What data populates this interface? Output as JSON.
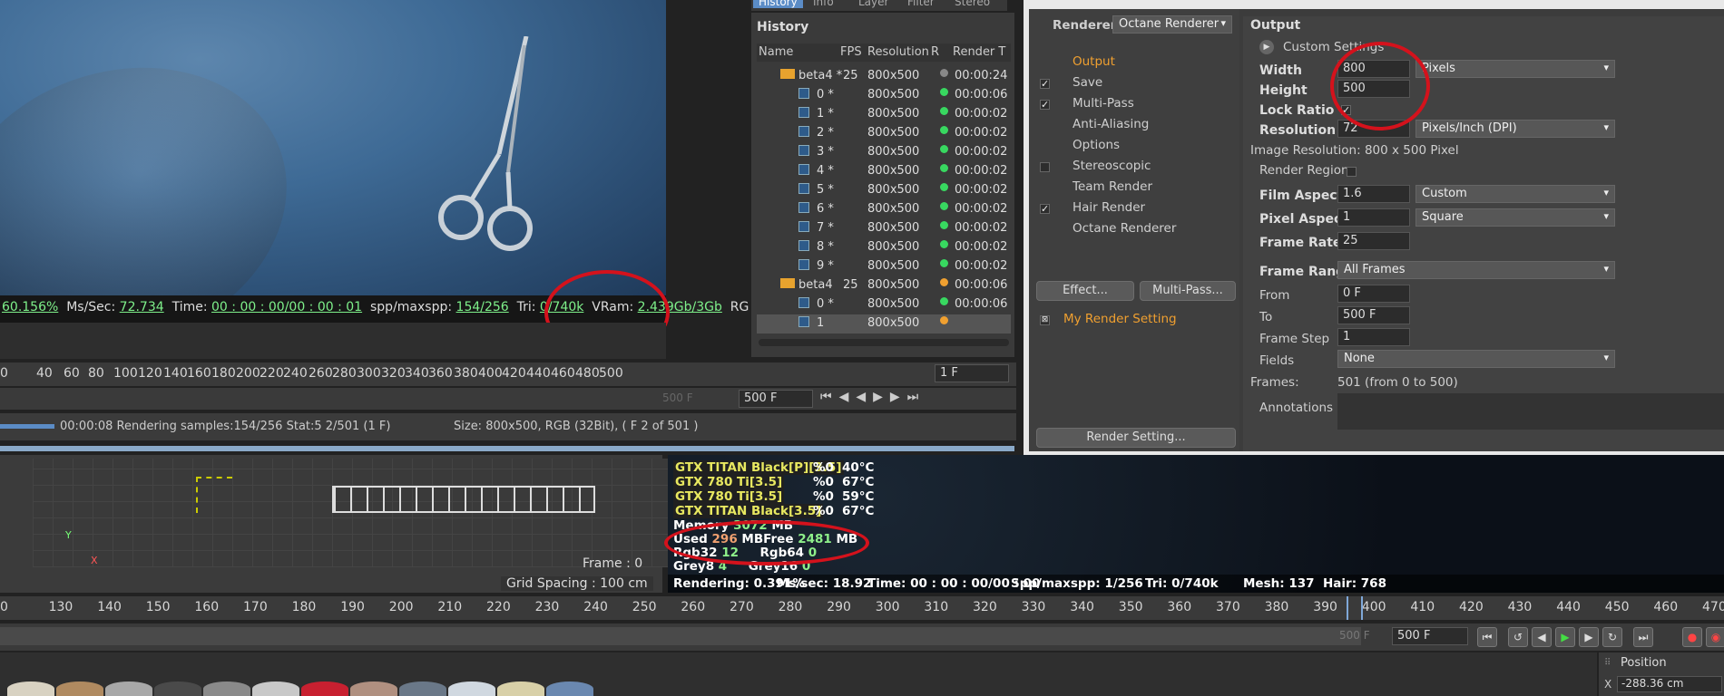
{
  "render_stats": {
    "progress": "60.156%",
    "ms_label": "Ms/Sec:",
    "ms_value": "72.734",
    "time_label": "Time:",
    "time_value": "00 : 00 : 00/00 : 00 : 01",
    "spp_label": "spp/maxspp:",
    "spp_value": "154/256",
    "tri_label": "Tri:",
    "tri_value": "0/740k",
    "vram_label": "VRam:",
    "vram_value": "2.439Gb/3Gb",
    "rg": "RG"
  },
  "top_ruler": [
    "0",
    "40",
    "60",
    "80",
    "100",
    "120",
    "140",
    "160",
    "180",
    "200",
    "220",
    "240",
    "260",
    "280",
    "300",
    "320",
    "340",
    "360",
    "380",
    "400",
    "420",
    "440",
    "460",
    "480",
    "500"
  ],
  "frame_field": "1 F",
  "end_frame_ghost": "500 F",
  "end_frame": "500 F",
  "status_left": "00:00:08 Rendering samples:154/256 Stat:5 2/501 (1 F)",
  "status_right": "Size: 800x500, RGB (32Bit),  ( F 2 of 501 )",
  "history": {
    "tabs": [
      "History",
      "Info",
      "Layer",
      "Filter",
      "Stereo"
    ],
    "title": "History",
    "columns": [
      "Name",
      "FPS",
      "Resolution",
      "R",
      "Render T"
    ],
    "rows": [
      {
        "name": "beta4 *",
        "fps": "25",
        "res": "800x500",
        "status": "gray",
        "time": "00:00:24"
      },
      {
        "name": "0 *",
        "fps": "",
        "res": "800x500",
        "status": "green",
        "time": "00:00:06"
      },
      {
        "name": "1 *",
        "fps": "",
        "res": "800x500",
        "status": "green",
        "time": "00:00:02"
      },
      {
        "name": "2 *",
        "fps": "",
        "res": "800x500",
        "status": "green",
        "time": "00:00:02"
      },
      {
        "name": "3 *",
        "fps": "",
        "res": "800x500",
        "status": "green",
        "time": "00:00:02"
      },
      {
        "name": "4 *",
        "fps": "",
        "res": "800x500",
        "status": "green",
        "time": "00:00:02"
      },
      {
        "name": "5 *",
        "fps": "",
        "res": "800x500",
        "status": "green",
        "time": "00:00:02"
      },
      {
        "name": "6 *",
        "fps": "",
        "res": "800x500",
        "status": "green",
        "time": "00:00:02"
      },
      {
        "name": "7 *",
        "fps": "",
        "res": "800x500",
        "status": "green",
        "time": "00:00:02"
      },
      {
        "name": "8 *",
        "fps": "",
        "res": "800x500",
        "status": "green",
        "time": "00:00:02"
      },
      {
        "name": "9 *",
        "fps": "",
        "res": "800x500",
        "status": "green",
        "time": "00:00:02"
      },
      {
        "name": "beta4",
        "fps": "25",
        "res": "800x500",
        "status": "orange",
        "time": "00:00:06"
      },
      {
        "name": "0 *",
        "fps": "",
        "res": "800x500",
        "status": "green",
        "time": "00:00:06"
      },
      {
        "name": "1",
        "fps": "",
        "res": "800x500",
        "status": "orange",
        "time": ""
      }
    ]
  },
  "render_settings": {
    "renderer_label": "Renderer",
    "renderer_value": "Octane Renderer",
    "left_items": [
      "Output",
      "Save",
      "Multi-Pass",
      "Anti-Aliasing",
      "Options",
      "Stereoscopic",
      "Team Render",
      "Hair Render",
      "Octane Renderer"
    ],
    "effect_btn": "Effect...",
    "multipass_btn": "Multi-Pass...",
    "preset": "My Render Setting",
    "render_setting_btn": "Render Setting...",
    "output_title": "Output",
    "custom_settings": "Custom Settings",
    "width_label": "Width",
    "width_value": "800",
    "units": "Pixels",
    "height_label": "Height",
    "height_value": "500",
    "lock_label": "Lock Ratio",
    "resolution_label": "Resolution",
    "resolution_value": "72",
    "resolution_unit": "Pixels/Inch (DPI)",
    "image_resolution": "Image Resolution: 800 x 500 Pixel",
    "render_region": "Render Region",
    "film_aspect_label": "Film Aspect",
    "film_aspect_value": "1.6",
    "film_aspect_mode": "Custom",
    "pixel_aspect_label": "Pixel Aspect",
    "pixel_aspect_value": "1",
    "pixel_aspect_mode": "Square",
    "frame_rate_label": "Frame Rate",
    "frame_rate_value": "25",
    "frame_range_label": "Frame Range",
    "frame_range_value": "All Frames",
    "from_label": "From",
    "from_value": "0 F",
    "to_label": "To",
    "to_value": "500 F",
    "frame_step_label": "Frame Step",
    "frame_step_value": "1",
    "fields_label": "Fields",
    "fields_value": "None",
    "frames_label": "Frames:",
    "frames_value": "501 (from 0 to 500)",
    "annotations_label": "Annotations"
  },
  "viewport": {
    "frame": "Frame : 0",
    "grid": "Grid Spacing : 100 cm",
    "axis_y": "Y",
    "axis_x": "X"
  },
  "gpu_stats": {
    "gpus": [
      {
        "name": "GTX TITAN Black[P][3.5]",
        "load": "%0",
        "temp": "40°C"
      },
      {
        "name": "GTX 780 Ti[3.5]",
        "load": "%0",
        "temp": "67°C"
      },
      {
        "name": "GTX 780 Ti[3.5]",
        "load": "%0",
        "temp": "59°C"
      },
      {
        "name": "GTX TITAN Black[3.5]",
        "load": "%0",
        "temp": "67°C"
      }
    ],
    "memory_label": "Memory",
    "memory_value": "3072",
    "memory_unit": "MB",
    "used_label": "Used",
    "used_value": "296",
    "used_unit": "MB",
    "free_label": "Free",
    "free_value": "2481",
    "free_unit": "MB",
    "rgb32_label": "Rgb32",
    "rgb32_value": "12",
    "rgb64_label": "Rgb64",
    "rgb64_value": "0",
    "grey8_label": "Grey8",
    "grey8_value": "4",
    "grey16_label": "Grey16",
    "grey16_value": "0",
    "rendering": "Rendering: 0.391%",
    "ms": "Ms/sec: 18.92",
    "time": "Time: 00 : 00 : 00/00 : 00",
    "spp": "Spp/maxspp: 1/256",
    "tri": "Tri: 0/740k",
    "mesh": "Mesh: 137",
    "hair": "Hair: 768"
  },
  "bottom_ruler": [
    "0",
    "130",
    "140",
    "150",
    "160",
    "170",
    "180",
    "190",
    "200",
    "210",
    "220",
    "230",
    "240",
    "250",
    "260",
    "270",
    "280",
    "290",
    "300",
    "310",
    "320",
    "330",
    "340",
    "350",
    "360",
    "370",
    "380",
    "390",
    "400",
    "410",
    "420",
    "430",
    "440",
    "450",
    "460",
    "470"
  ],
  "bottom_end_ghost": "500 F",
  "bottom_end": "500 F",
  "position_title": "Position",
  "position_x_label": "X",
  "position_x_value": "-288.36 cm",
  "colors": {
    "accent": "#f0a030",
    "ring": "#d4121c",
    "green": "#38d860",
    "tab_active": "#5b8cc6"
  }
}
